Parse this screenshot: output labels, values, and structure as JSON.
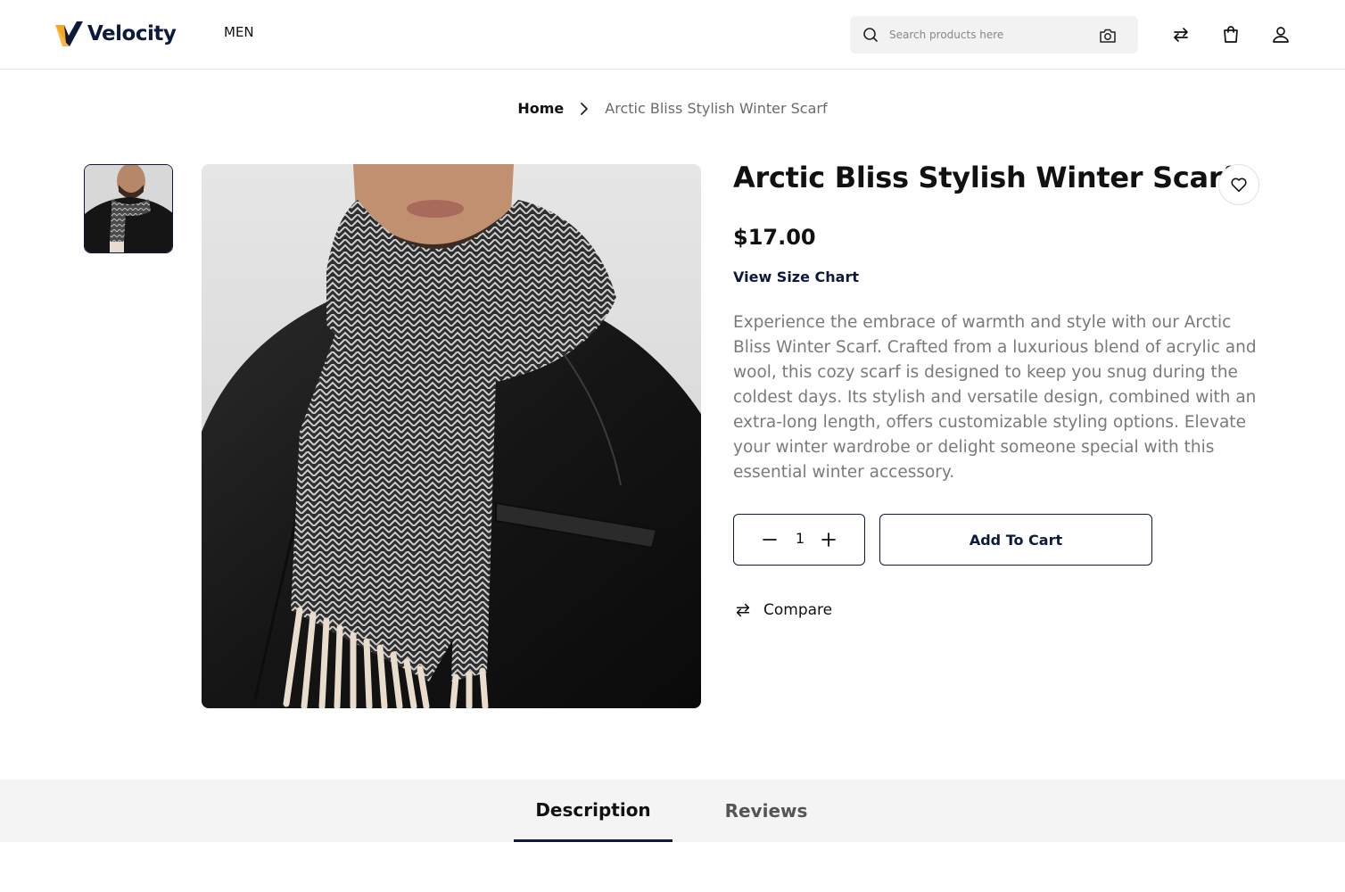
{
  "brand": {
    "name": "Velocity",
    "accent": "#f5a623",
    "navy": "#0e1a3c"
  },
  "nav": {
    "men_label": "MEN"
  },
  "search": {
    "placeholder": "Search products here"
  },
  "header_icons": [
    "compare-arrows-icon",
    "shopping-bag-icon",
    "user-icon"
  ],
  "breadcrumb": {
    "home": "Home",
    "current": "Arctic Bliss Stylish Winter Scarf"
  },
  "product": {
    "title": "Arctic Bliss Stylish Winter Scarf",
    "price": "$17.00",
    "size_chart_label": "View Size Chart",
    "description": "Experience the embrace of warmth and style with our Arctic Bliss Winter Scarf. Crafted from a luxurious blend of acrylic and wool, this cozy scarf is designed to keep you snug during the coldest days. Its stylish and versatile design, combined with an extra-long length, offers customizable styling options. Elevate your winter wardrobe or delight someone special with this essential winter accessory.",
    "quantity": "1",
    "add_to_cart_label": "Add To Cart",
    "compare_label": "Compare"
  },
  "tabs": [
    {
      "label": "Description",
      "active": true
    },
    {
      "label": "Reviews",
      "active": false
    }
  ]
}
